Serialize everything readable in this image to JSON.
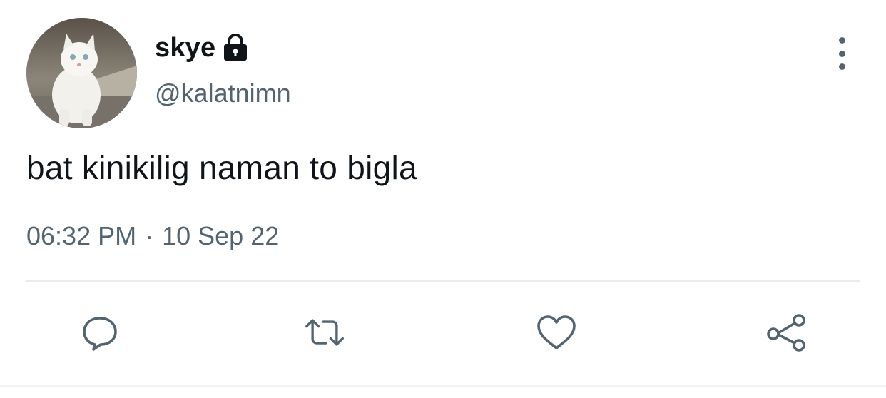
{
  "user": {
    "display_name": "skye",
    "handle": "@kalatnimn",
    "protected_icon": "lock-icon",
    "avatar": "avatar"
  },
  "tweet": {
    "text": "bat kinikilig naman to bigla",
    "time": "06:32 PM",
    "separator": "·",
    "date": "10 Sep 22"
  },
  "actions": [
    {
      "icon": "reply-icon"
    },
    {
      "icon": "retweet-icon"
    },
    {
      "icon": "like-icon"
    },
    {
      "icon": "share-icon"
    }
  ],
  "menu": {
    "icon": "more-options-icon"
  },
  "colors": {
    "primary_text": "#0f1419",
    "secondary_text": "#536471",
    "divider": "#e6ecf0"
  }
}
